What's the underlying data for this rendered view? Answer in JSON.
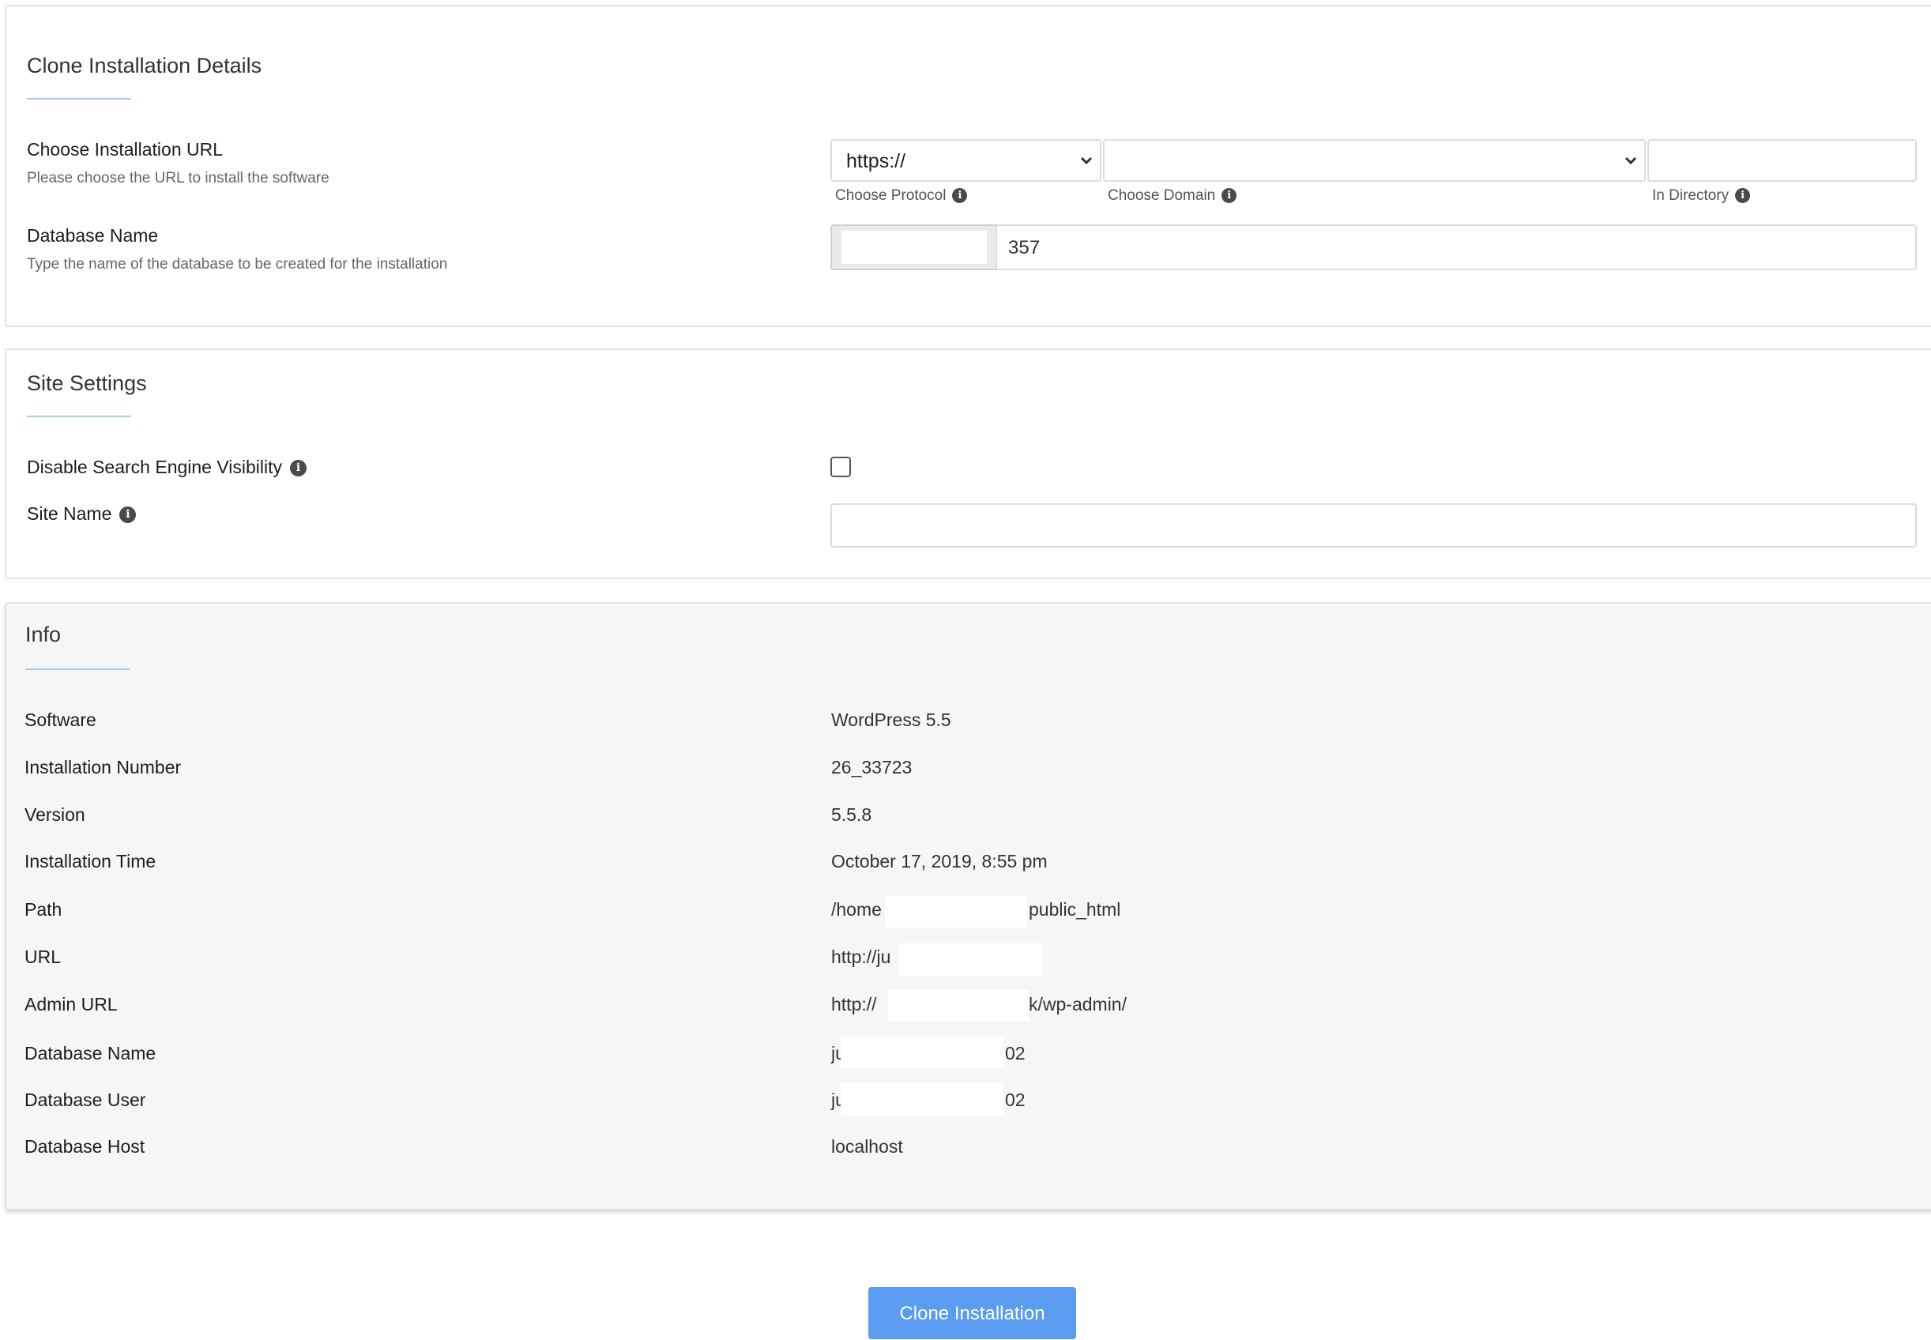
{
  "clone_section": {
    "title": "Clone Installation Details",
    "installation_url": {
      "label": "Choose Installation URL",
      "help": "Please choose the URL to install the software",
      "protocol_value": "https://",
      "protocol_caption": "Choose Protocol",
      "domain_value": "",
      "domain_caption": "Choose Domain",
      "directory_value": "",
      "directory_caption": "In Directory"
    },
    "database_name": {
      "label": "Database Name",
      "help": "Type the name of the database to be created for the installation",
      "prefix_value": "",
      "suffix_value": "357"
    }
  },
  "site_settings": {
    "title": "Site Settings",
    "disable_search_engine_visibility": {
      "label": "Disable Search Engine Visibility",
      "checked": false
    },
    "site_name": {
      "label": "Site Name",
      "value": ""
    }
  },
  "info": {
    "title": "Info",
    "rows": [
      {
        "label": "Software",
        "value": "WordPress 5.5"
      },
      {
        "label": "Installation Number",
        "value": "26_33723"
      },
      {
        "label": "Version",
        "value": "5.5.8"
      },
      {
        "label": "Installation Time",
        "value": "October 17, 2019, 8:55 pm"
      },
      {
        "label": "Path",
        "value": "/home",
        "value_tail": "public_html"
      },
      {
        "label": "URL",
        "value": "http://ju"
      },
      {
        "label": "Admin URL",
        "value": "http://",
        "value_tail": "k/wp-admin/"
      },
      {
        "label": "Database Name",
        "value": "ju",
        "value_tail": "02"
      },
      {
        "label": "Database User",
        "value": "ju",
        "value_tail": "02"
      },
      {
        "label": "Database Host",
        "value": "localhost"
      }
    ]
  },
  "actions": {
    "clone_button": "Clone Installation"
  },
  "icons": {
    "info": "info-circle-icon",
    "dropdown": "chevron-down-icon"
  },
  "colors": {
    "accent": "#5a9cf0",
    "underline": "#a9c9ef",
    "info_panel_bg": "#f6f6f6"
  }
}
